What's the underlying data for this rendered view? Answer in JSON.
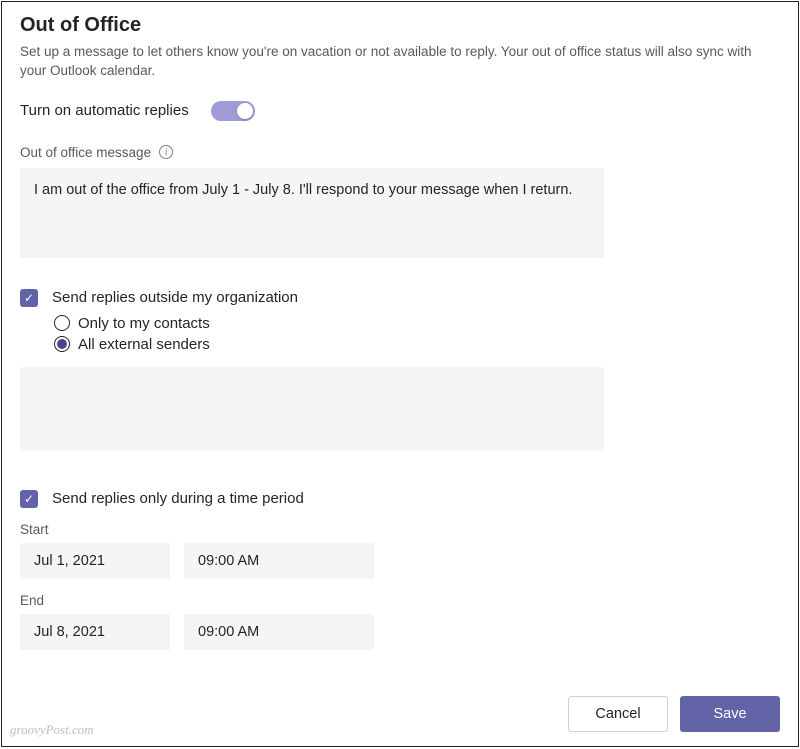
{
  "title": "Out of Office",
  "subtitle": "Set up a message to let others know you're on vacation or not available to reply. Your out of office status will also sync with your Outlook calendar.",
  "toggle": {
    "label": "Turn on automatic replies",
    "on": true
  },
  "message": {
    "label": "Out of office message",
    "value": "I am out of the office from July 1 - July 8. I'll respond to your message when I return."
  },
  "external": {
    "checkbox_label": "Send replies outside my organization",
    "checked": true,
    "radios": {
      "only_contacts": "Only to my contacts",
      "all_external": "All external senders",
      "selected": "all_external"
    },
    "message_value": ""
  },
  "period": {
    "checkbox_label": "Send replies only during a time period",
    "checked": true,
    "start_label": "Start",
    "start_date": "Jul 1, 2021",
    "start_time": "09:00 AM",
    "end_label": "End",
    "end_date": "Jul 8, 2021",
    "end_time": "09:00 AM"
  },
  "buttons": {
    "cancel": "Cancel",
    "save": "Save"
  },
  "watermark": "groovyPost.com"
}
